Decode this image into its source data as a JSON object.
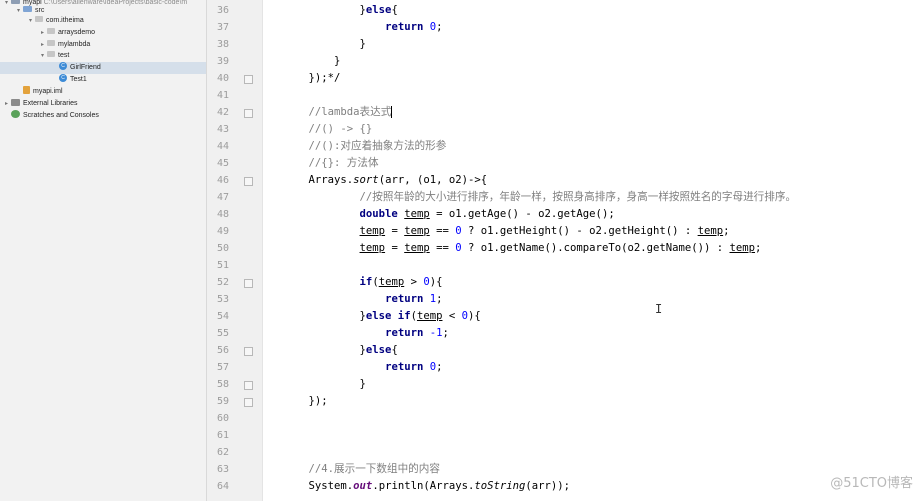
{
  "project_tree": [
    {
      "label": "myapi",
      "path": "C:\\Users\\alienware\\IdeaProjects\\basic-code\\m",
      "icon": "module-folder-icon",
      "indent": 0,
      "arrow": "▾"
    },
    {
      "label": "src",
      "icon": "source-folder-icon",
      "indent": 1,
      "arrow": "▾"
    },
    {
      "label": "com.itheima",
      "icon": "package-icon",
      "indent": 2,
      "arrow": "▾"
    },
    {
      "label": "arraysdemo",
      "icon": "package-icon",
      "indent": 3,
      "arrow": "▸"
    },
    {
      "label": "mylambda",
      "icon": "package-icon",
      "indent": 3,
      "arrow": "▸"
    },
    {
      "label": "test",
      "icon": "package-icon",
      "indent": 3,
      "arrow": "▾"
    },
    {
      "label": "GirlFriend",
      "icon": "class-icon",
      "indent": 4,
      "arrow": "",
      "selected": true
    },
    {
      "label": "Test1",
      "icon": "class-icon",
      "indent": 4,
      "arrow": ""
    },
    {
      "label": "myapi.iml",
      "icon": "iml-file-icon",
      "indent": 1,
      "arrow": ""
    },
    {
      "label": "External Libraries",
      "icon": "library-icon",
      "indent": 0,
      "arrow": "▸"
    },
    {
      "label": "Scratches and Consoles",
      "icon": "scratches-icon",
      "indent": 0,
      "arrow": ""
    }
  ],
  "editor": {
    "line_numbers": [
      "36",
      "37",
      "38",
      "39",
      "40",
      "41",
      "42",
      "43",
      "44",
      "45",
      "46",
      "47",
      "48",
      "49",
      "50",
      "51",
      "52",
      "53",
      "54",
      "55",
      "56",
      "57",
      "58",
      "59",
      "60",
      "61",
      "62",
      "63",
      "64"
    ],
    "current_line": "42",
    "lines": [
      [
        {
          "t": "            }",
          "c": ""
        },
        {
          "t": "else",
          "c": "kw"
        },
        {
          "t": "{",
          "c": ""
        }
      ],
      [
        {
          "t": "                ",
          "c": ""
        },
        {
          "t": "return",
          "c": "kw"
        },
        {
          "t": " ",
          "c": ""
        },
        {
          "t": "0",
          "c": "num"
        },
        {
          "t": ";",
          "c": ""
        }
      ],
      [
        {
          "t": "            }",
          "c": ""
        }
      ],
      [
        {
          "t": "        }",
          "c": ""
        }
      ],
      [
        {
          "t": "    });*/",
          "c": ""
        }
      ],
      [],
      [
        {
          "t": "    //lambda表达式",
          "c": "cm"
        }
      ],
      [
        {
          "t": "    //() -> {}",
          "c": "cm"
        }
      ],
      [
        {
          "t": "    //():对应着抽象方法的形参",
          "c": "cm"
        }
      ],
      [
        {
          "t": "    //{}: 方法体",
          "c": "cm"
        }
      ],
      [
        {
          "t": "    Arrays.",
          "c": ""
        },
        {
          "t": "sort",
          "c": "st"
        },
        {
          "t": "(arr, (o1, o2)->{",
          "c": ""
        }
      ],
      [
        {
          "t": "            //按照年龄的大小进行排序，年龄一样，按照身高排序，身高一样按照姓名的字母进行排序。",
          "c": "cm"
        }
      ],
      [
        {
          "t": "            ",
          "c": ""
        },
        {
          "t": "double",
          "c": "kw"
        },
        {
          "t": " ",
          "c": ""
        },
        {
          "t": "temp",
          "c": "ul"
        },
        {
          "t": " = o1.getAge() - o2.getAge();",
          "c": ""
        }
      ],
      [
        {
          "t": "            ",
          "c": ""
        },
        {
          "t": "temp",
          "c": "ul"
        },
        {
          "t": " = ",
          "c": ""
        },
        {
          "t": "temp",
          "c": "ul"
        },
        {
          "t": " == ",
          "c": ""
        },
        {
          "t": "0",
          "c": "num"
        },
        {
          "t": " ? o1.getHeight() - o2.getHeight() : ",
          "c": ""
        },
        {
          "t": "temp",
          "c": "ul"
        },
        {
          "t": ";",
          "c": ""
        }
      ],
      [
        {
          "t": "            ",
          "c": ""
        },
        {
          "t": "temp",
          "c": "ul"
        },
        {
          "t": " = ",
          "c": ""
        },
        {
          "t": "temp",
          "c": "ul"
        },
        {
          "t": " == ",
          "c": ""
        },
        {
          "t": "0",
          "c": "num"
        },
        {
          "t": " ? o1.getName().compareTo(o2.getName()) : ",
          "c": ""
        },
        {
          "t": "temp",
          "c": "ul"
        },
        {
          "t": ";",
          "c": ""
        }
      ],
      [],
      [
        {
          "t": "            ",
          "c": ""
        },
        {
          "t": "if",
          "c": "kw"
        },
        {
          "t": "(",
          "c": ""
        },
        {
          "t": "temp",
          "c": "ul"
        },
        {
          "t": " > ",
          "c": ""
        },
        {
          "t": "0",
          "c": "num"
        },
        {
          "t": "){",
          "c": ""
        }
      ],
      [
        {
          "t": "                ",
          "c": ""
        },
        {
          "t": "return",
          "c": "kw"
        },
        {
          "t": " ",
          "c": ""
        },
        {
          "t": "1",
          "c": "num"
        },
        {
          "t": ";",
          "c": ""
        }
      ],
      [
        {
          "t": "            }",
          "c": ""
        },
        {
          "t": "else if",
          "c": "kw"
        },
        {
          "t": "(",
          "c": ""
        },
        {
          "t": "temp",
          "c": "ul"
        },
        {
          "t": " < ",
          "c": ""
        },
        {
          "t": "0",
          "c": "num"
        },
        {
          "t": "){",
          "c": ""
        }
      ],
      [
        {
          "t": "                ",
          "c": ""
        },
        {
          "t": "return",
          "c": "kw"
        },
        {
          "t": " ",
          "c": ""
        },
        {
          "t": "-1",
          "c": "num"
        },
        {
          "t": ";",
          "c": ""
        }
      ],
      [
        {
          "t": "            }",
          "c": ""
        },
        {
          "t": "else",
          "c": "kw"
        },
        {
          "t": "{",
          "c": ""
        }
      ],
      [
        {
          "t": "                ",
          "c": ""
        },
        {
          "t": "return",
          "c": "kw"
        },
        {
          "t": " ",
          "c": ""
        },
        {
          "t": "0",
          "c": "num"
        },
        {
          "t": ";",
          "c": ""
        }
      ],
      [
        {
          "t": "            }",
          "c": ""
        }
      ],
      [
        {
          "t": "    });",
          "c": ""
        }
      ],
      [],
      [],
      [],
      [
        {
          "t": "    //4.展示一下数组中的内容",
          "c": "cm"
        }
      ],
      [
        {
          "t": "    System.",
          "c": ""
        },
        {
          "t": "out",
          "c": "fld"
        },
        {
          "t": ".println(Arrays.",
          "c": ""
        },
        {
          "t": "toString",
          "c": "st"
        },
        {
          "t": "(arr));",
          "c": ""
        }
      ]
    ]
  },
  "watermark": "@51CTO博客",
  "colors": {
    "keyword": "#000080",
    "number": "#0000ff",
    "comment": "#808080",
    "field": "#660e7a",
    "current_line": "#fffae3"
  }
}
